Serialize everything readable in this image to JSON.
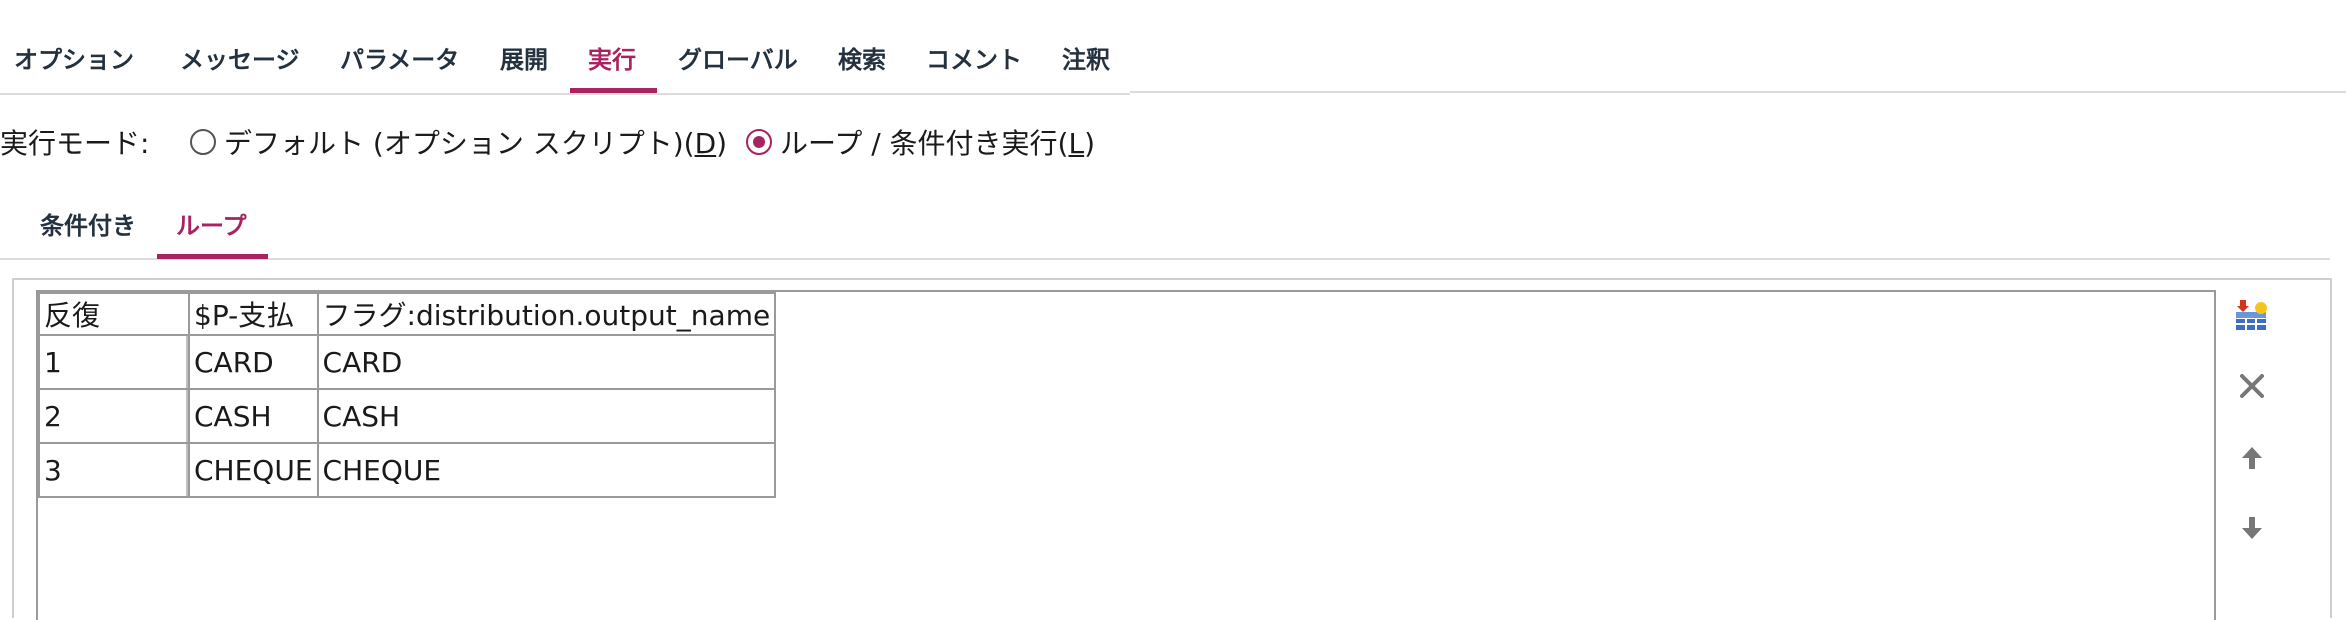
{
  "top_tabs": [
    "オプション",
    "メッセージ",
    "パラメータ",
    "展開",
    "実行",
    "グローバル",
    "検索",
    "コメント",
    "注釈"
  ],
  "top_tabs_active": "実行",
  "exec_mode": {
    "label": "実行モード:",
    "options": [
      {
        "pre": "デフォルト (オプション スクリプト)(",
        "key": "D",
        "post": ")",
        "selected": false
      },
      {
        "pre": "ループ / 条件付き実行(",
        "key": "L",
        "post": ")",
        "selected": true
      }
    ]
  },
  "sub_tabs": [
    "条件付き",
    "ループ"
  ],
  "sub_tabs_active": "ループ",
  "table": {
    "headers": [
      "反復",
      "$P-支払",
      "フラグ:distribution.output_name"
    ],
    "rows": [
      [
        "1",
        "CARD",
        "CARD"
      ],
      [
        "2",
        "CASH",
        "CASH"
      ],
      [
        "3",
        "CHEQUE",
        "CHEQUE"
      ]
    ]
  },
  "toolbar": {
    "icons": [
      "add-row-icon",
      "delete-icon",
      "move-up-icon",
      "move-down-icon"
    ]
  },
  "colors": {
    "accent": "#a8235f",
    "tab_text": "#24323f",
    "border": "#9a9a9a"
  }
}
